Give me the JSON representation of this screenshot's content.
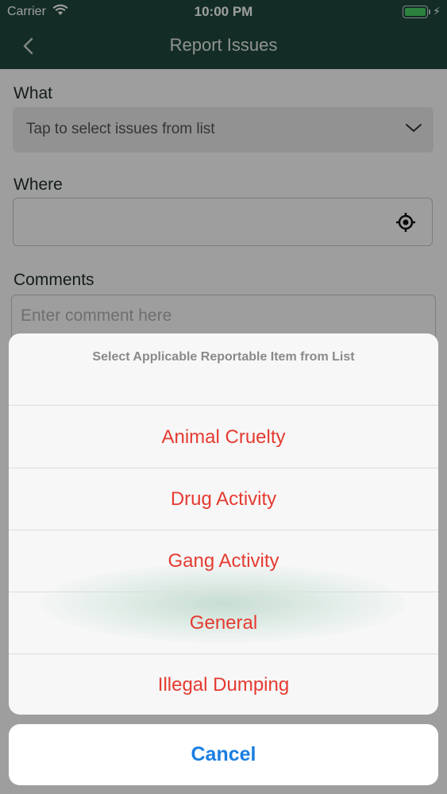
{
  "status_bar": {
    "carrier": "Carrier",
    "time": "10:00 PM"
  },
  "nav": {
    "title": "Report Issues",
    "back_icon": "chevron-left-icon"
  },
  "form": {
    "what_label": "What",
    "what_placeholder": "Tap to select issues from list",
    "where_label": "Where",
    "where_value": "",
    "comments_label": "Comments",
    "comments_placeholder": "Enter comment here"
  },
  "action_sheet": {
    "title": "Select Applicable Reportable Item from List",
    "items": [
      {
        "label": "Animal Cruelty"
      },
      {
        "label": "Drug Activity"
      },
      {
        "label": "Gang Activity"
      },
      {
        "label": "General"
      },
      {
        "label": "Illegal Dumping"
      }
    ],
    "cancel_label": "Cancel"
  },
  "colors": {
    "header_bg": "#1f4a3e",
    "destructive_text": "#e53b30",
    "cancel_text": "#1a7ee2",
    "battery_fill": "#48d264"
  }
}
